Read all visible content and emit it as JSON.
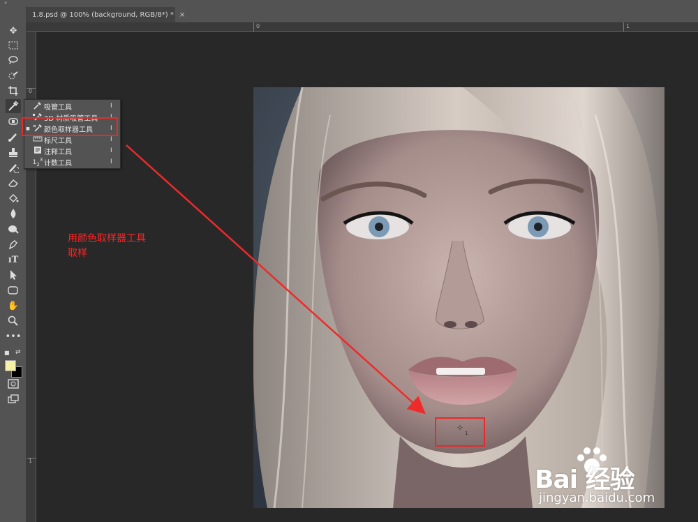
{
  "topbar": {
    "collapse_glyph": "»"
  },
  "document": {
    "tab_title": "1.8.psd @ 100% (background, RGB/8*) *",
    "close_glyph": "×"
  },
  "rulers": {
    "top_labels": [
      "0",
      "1"
    ],
    "left_labels": [
      "0",
      "1"
    ]
  },
  "toolbar": {
    "tools": [
      "move",
      "marquee",
      "lasso",
      "quick-selection",
      "crop",
      "eyedropper",
      "spot-healing",
      "brush",
      "clone-stamp",
      "history-brush",
      "eraser",
      "paint-bucket",
      "blur",
      "dodge",
      "pen",
      "type",
      "path-selection",
      "rectangle",
      "hand",
      "zoom",
      "more-tools",
      "quick-mask",
      "screen-mode"
    ],
    "active_tool": "eyedropper",
    "foreground_color": "#f6f1a6",
    "background_color": "#000000"
  },
  "flyout": {
    "items": [
      {
        "label": "吸管工具",
        "shortcut": "I",
        "icon": "eyedropper-icon",
        "selected": false
      },
      {
        "label": "3D 材质吸管工具",
        "shortcut": "I",
        "icon": "3d-material-eyedropper-icon",
        "selected": false
      },
      {
        "label": "颜色取样器工具",
        "shortcut": "I",
        "icon": "color-sampler-icon",
        "selected": true
      },
      {
        "label": "标尺工具",
        "shortcut": "I",
        "icon": "ruler-icon",
        "selected": false
      },
      {
        "label": "注释工具",
        "shortcut": "I",
        "icon": "note-icon",
        "selected": false
      },
      {
        "label": "计数工具",
        "shortcut": "I",
        "icon": "count-icon",
        "selected": false
      }
    ]
  },
  "annotation": {
    "line1": "用颜色取样器工具",
    "line2": "取样",
    "color": "#ff2323"
  },
  "sampler": {
    "index": "1"
  },
  "watermark": {
    "logo": "Bai 经验",
    "url": "jingyan.baidu.com"
  }
}
